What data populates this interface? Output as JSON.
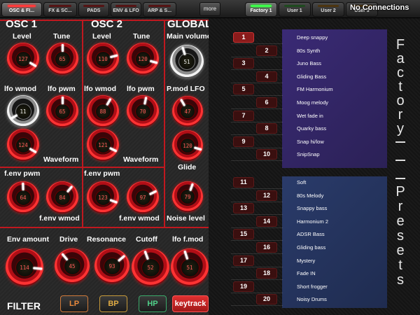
{
  "tabs": [
    {
      "label": "OSC & FI...",
      "left": 0
    },
    {
      "label": "FX & SC...",
      "left": 0
    },
    {
      "label": "PADS",
      "left": 0
    },
    {
      "label": "ENV & LFO",
      "left": 0
    },
    {
      "label": "ARP & S...",
      "left": 0
    }
  ],
  "more_label": "more",
  "preset_tabs": [
    "Factory 1",
    "User 1",
    "User 2",
    "User 3"
  ],
  "connection_status": "No Connections",
  "sections": {
    "osc1": "OSC 1",
    "osc2": "OSC 2",
    "global": "GLOBAL",
    "filter": "FILTER"
  },
  "osc1": {
    "level": {
      "label": "Level",
      "value": "127"
    },
    "tune": {
      "label": "Tune",
      "value": "65"
    },
    "lfo_wmod": {
      "label": "lfo wmod",
      "value": "11"
    },
    "lfo_pwm": {
      "label": "lfo pwm",
      "value": "65"
    },
    "waveform": {
      "label": "Waveform",
      "value": "124"
    },
    "fenv_pwm": {
      "label": "f.env pwm",
      "value": "64"
    },
    "fenv_wmod": {
      "label": "f.env wmod",
      "value": "84"
    }
  },
  "osc2": {
    "level": {
      "label": "Level",
      "value": "110"
    },
    "tune": {
      "label": "Tune",
      "value": "120"
    },
    "lfo_wmod": {
      "label": "lfo wmod",
      "value": "88"
    },
    "lfo_pwm": {
      "label": "lfo pwm",
      "value": "70"
    },
    "waveform": {
      "label": "Waveform",
      "value": "121"
    },
    "fenv_pwm": {
      "label": "f.env pwm",
      "value": "123"
    },
    "fenv_wmod": {
      "label": "f.env wmod",
      "value": "97"
    }
  },
  "global": {
    "main_volume": {
      "label": "Main volume",
      "value": "51"
    },
    "pmod_lfo": {
      "label": "P.mod LFO",
      "value": "47"
    },
    "glide": {
      "label": "Glide",
      "value": "120"
    },
    "noise_level": {
      "label": "Noise level",
      "value": "79"
    }
  },
  "filter": {
    "env_amount": {
      "label": "Env amount",
      "value": "114"
    },
    "drive": {
      "label": "Drive",
      "value": "45"
    },
    "resonance": {
      "label": "Resonance",
      "value": "93"
    },
    "cutoff": {
      "label": "Cutoff",
      "value": "52"
    },
    "lfo_fmod": {
      "label": "lfo f.mod",
      "value": "51"
    },
    "buttons": [
      "LP",
      "BP",
      "HP",
      "keytrack"
    ]
  },
  "factory_presets": [
    "Deep snappy",
    "80s Synth",
    "Juno Bass",
    "Gliding Bass",
    "FM Harmonium",
    "Moog melody",
    "Wet fade in",
    "Quarky bass",
    "Snap hi/low",
    "SnipSnap"
  ],
  "user_presets": [
    "Soft",
    "80s Melody",
    "Snappy bass",
    "Harmonium 2",
    "ADSR Bass",
    "Gliding bass",
    "Mystery",
    "Fade IN",
    "Short frogger",
    "Noisy Drums"
  ],
  "preset_numbers_factory": [
    "1",
    "2",
    "3",
    "4",
    "5",
    "6",
    "7",
    "8",
    "9",
    "10"
  ],
  "preset_numbers_user": [
    "11",
    "12",
    "13",
    "14",
    "15",
    "16",
    "17",
    "18",
    "19",
    "20"
  ],
  "vertical_label": "Factory — — Presets",
  "colors": {
    "accent": "#c0181f",
    "factory_box": "#3a2a75",
    "user_box": "#2a3b6a",
    "led_green": "#3cff4a"
  }
}
